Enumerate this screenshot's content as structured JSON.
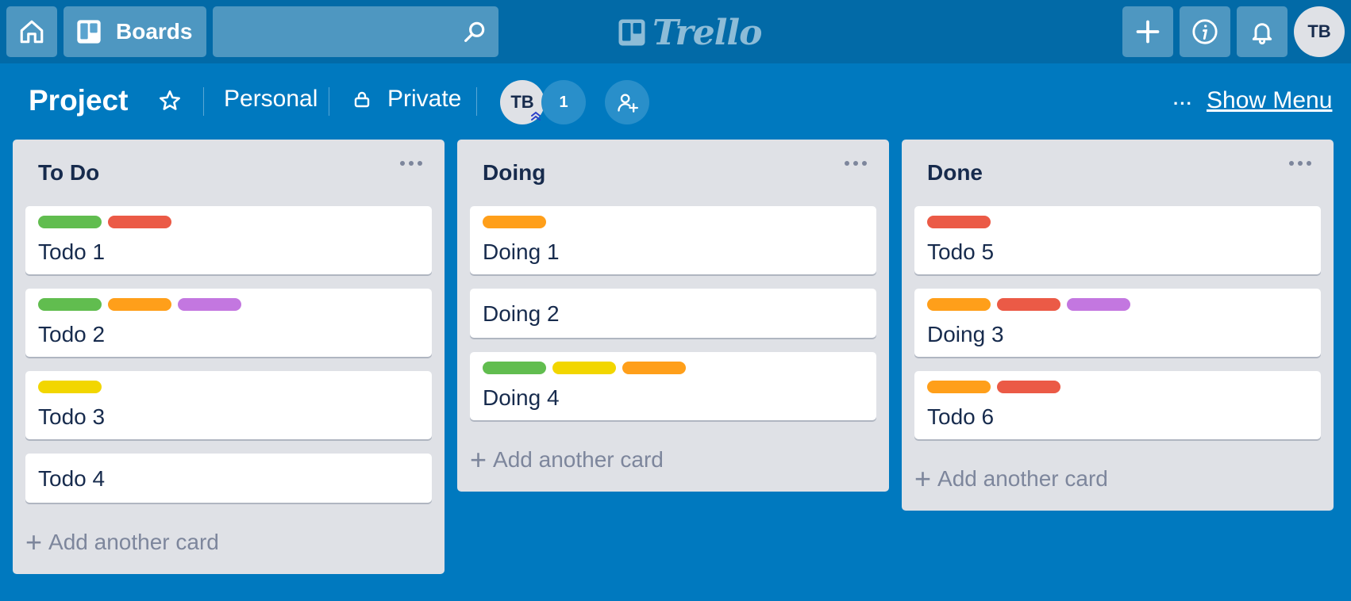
{
  "header": {
    "boards_label": "Boards",
    "search": {
      "value": "",
      "placeholder": ""
    },
    "logo_text": "Trello",
    "avatar_initials": "TB"
  },
  "board": {
    "title": "Project",
    "team": "Personal",
    "visibility": "Private",
    "member_initials": "TB",
    "member_count": "1",
    "more_label": "···",
    "show_menu": "Show Menu"
  },
  "colors": {
    "background": "#0079bf",
    "header": "#026aa7",
    "green": "#61bd4f",
    "red": "#eb5a46",
    "orange": "#ff9f1a",
    "purple": "#c377e0",
    "yellow": "#f2d600"
  },
  "lists": [
    {
      "title": "To Do",
      "add_label": "Add another card",
      "cards": [
        {
          "title": "Todo 1",
          "labels": [
            "green",
            "red"
          ]
        },
        {
          "title": "Todo 2",
          "labels": [
            "green",
            "orange",
            "purple"
          ]
        },
        {
          "title": "Todo 3",
          "labels": [
            "yellow"
          ]
        },
        {
          "title": "Todo 4",
          "labels": []
        }
      ]
    },
    {
      "title": "Doing",
      "add_label": "Add another card",
      "cards": [
        {
          "title": "Doing 1",
          "labels": [
            "orange"
          ]
        },
        {
          "title": "Doing 2",
          "labels": []
        },
        {
          "title": "Doing 4",
          "labels": [
            "green",
            "yellow",
            "orange"
          ]
        }
      ]
    },
    {
      "title": "Done",
      "add_label": "Add another card",
      "cards": [
        {
          "title": "Todo 5",
          "labels": [
            "red"
          ]
        },
        {
          "title": "Doing 3",
          "labels": [
            "orange",
            "red",
            "purple"
          ]
        },
        {
          "title": "Todo 6",
          "labels": [
            "orange",
            "red"
          ]
        }
      ]
    }
  ]
}
